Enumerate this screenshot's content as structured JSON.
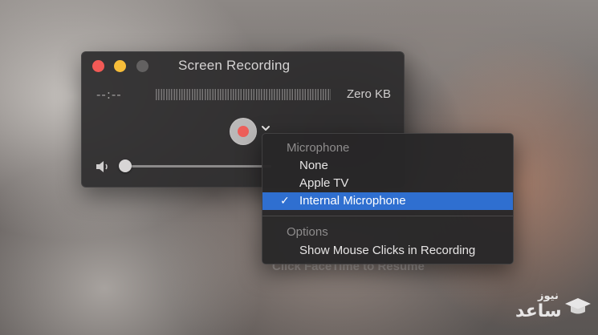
{
  "window": {
    "title": "Screen Recording",
    "time": "--:--",
    "file_size": "Zero KB"
  },
  "menu": {
    "microphone_header": "Microphone",
    "microphone_items": [
      {
        "label": "None",
        "selected": false
      },
      {
        "label": "Apple TV",
        "selected": false
      },
      {
        "label": "Internal Microphone",
        "selected": true
      }
    ],
    "check_mark": "✓",
    "options_header": "Options",
    "options_items": [
      {
        "label": "Show Mouse Clicks in Recording"
      }
    ]
  },
  "background": {
    "hint_text": "Click FaceTime to Resume"
  },
  "watermark": {
    "text_main": "ساعد",
    "text_small": "نیوز"
  },
  "colors": {
    "record_red": "#ee5f5a",
    "selection_blue": "#2f6fd0",
    "close_red": "#f25a56",
    "minimize_yellow": "#f7bd39"
  }
}
